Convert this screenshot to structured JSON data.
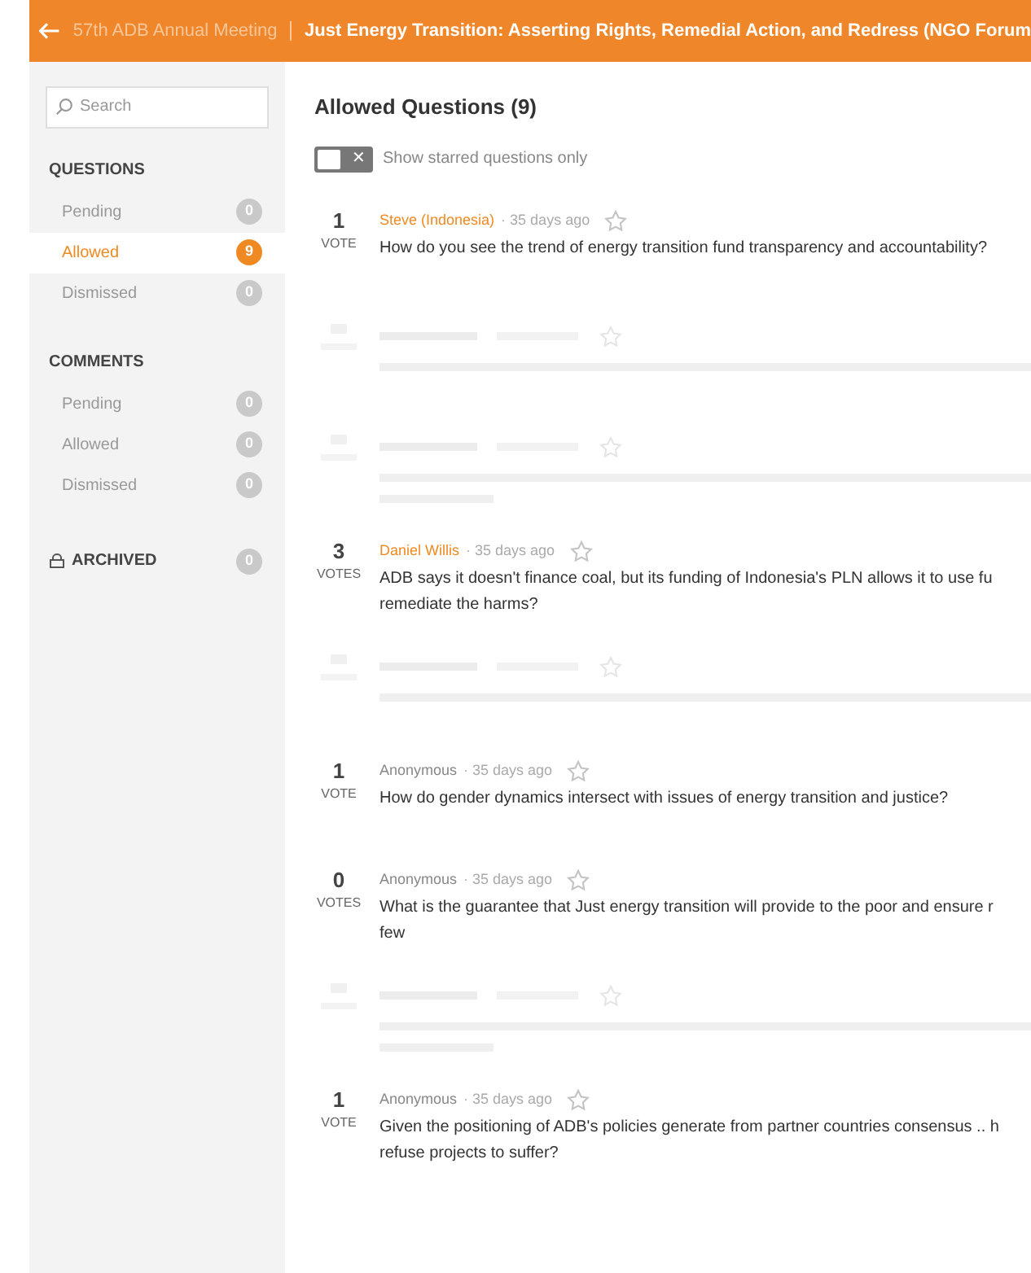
{
  "header": {
    "breadcrumb": "57th ADB Annual Meeting",
    "title": "Just Energy Transition: Asserting Rights, Remedial Action, and Redress (NGO Forum"
  },
  "sidebar": {
    "search": {
      "placeholder": "Search"
    },
    "sections": [
      {
        "kind": "heading",
        "title": "QUESTIONS",
        "items": [
          {
            "label": "Pending",
            "count": "0",
            "selected": false
          },
          {
            "label": "Allowed",
            "count": "9",
            "selected": true
          },
          {
            "label": "Dismissed",
            "count": "0",
            "selected": false
          }
        ]
      },
      {
        "kind": "heading",
        "title": "COMMENTS",
        "items": [
          {
            "label": "Pending",
            "count": "0",
            "selected": false
          },
          {
            "label": "Allowed",
            "count": "0",
            "selected": false
          },
          {
            "label": "Dismissed",
            "count": "0",
            "selected": false
          }
        ]
      },
      {
        "kind": "archived",
        "title": "ARCHIVED",
        "count": "0"
      }
    ]
  },
  "main": {
    "title": "Allowed Questions (9)",
    "starred_toggle": {
      "label": "Show starred questions only",
      "on": false,
      "off_icon": "✕"
    },
    "questions": [
      {
        "kind": "question",
        "votes": "1",
        "vote_label": "VOTE",
        "author": "Steve (Indonesia)",
        "author_highlight": true,
        "time": "· 35 days ago",
        "lines": [
          "How do you see the trend of energy transition fund transparency and accountability?"
        ]
      },
      {
        "kind": "blurred"
      },
      {
        "kind": "blurredlong"
      },
      {
        "kind": "question",
        "votes": "3",
        "vote_label": "VOTES",
        "author": "Daniel Willis",
        "author_highlight": true,
        "time": "· 35 days ago",
        "lines": [
          "ADB says it doesn't finance coal, but its funding of Indonesia's PLN allows it to use fu",
          "remediate the harms?"
        ]
      },
      {
        "kind": "blurred"
      },
      {
        "kind": "question",
        "votes": "1",
        "vote_label": "VOTE",
        "author": "Anonymous",
        "author_highlight": false,
        "time": "· 35 days ago",
        "lines": [
          "How do gender dynamics intersect with issues of energy transition and justice?"
        ]
      },
      {
        "kind": "question",
        "votes": "0",
        "vote_label": "VOTES",
        "author": "Anonymous",
        "author_highlight": false,
        "time": "· 35 days ago",
        "lines": [
          "What is the guarantee that Just energy transition will provide to the poor and ensure r",
          "few"
        ]
      },
      {
        "kind": "blurredlong"
      },
      {
        "kind": "question",
        "votes": "1",
        "vote_label": "VOTE",
        "author": "Anonymous",
        "author_highlight": false,
        "time": "· 35 days ago",
        "lines": [
          "Given the positioning of ADB's policies generate from partner countries consensus .. h",
          "refuse projects to suffer?"
        ]
      }
    ]
  }
}
